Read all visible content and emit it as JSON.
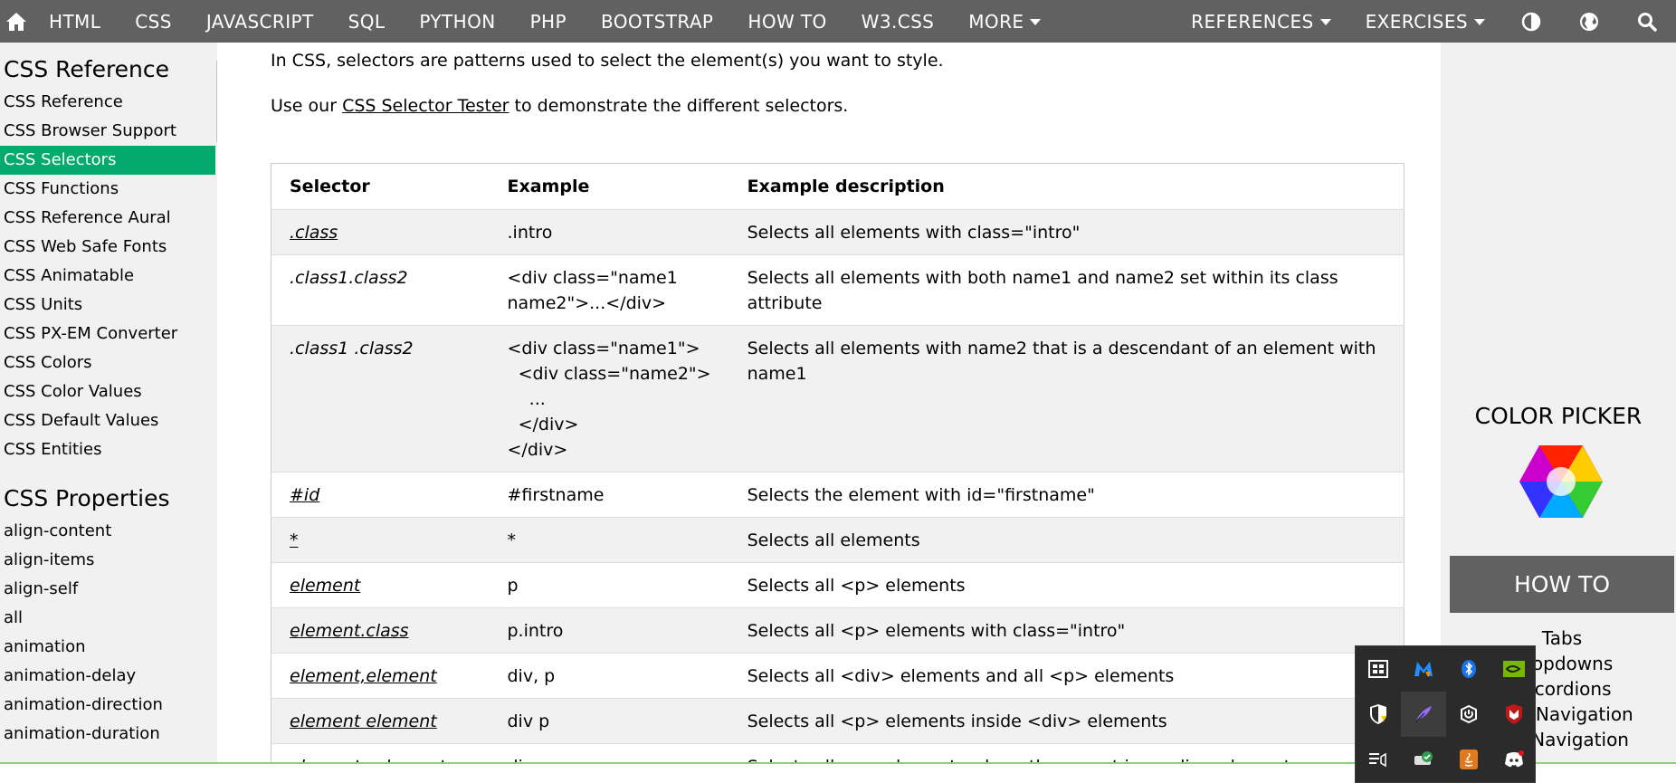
{
  "topnav": {
    "home_icon": "home-icon",
    "items": [
      "HTML",
      "CSS",
      "JAVASCRIPT",
      "SQL",
      "PYTHON",
      "PHP",
      "BOOTSTRAP",
      "HOW TO",
      "W3.CSS",
      "MORE"
    ],
    "right_items": [
      "REFERENCES",
      "EXERCISES"
    ],
    "icons": [
      "contrast-icon",
      "globe-icon",
      "search-icon"
    ]
  },
  "sidebar": {
    "heading1": "CSS Reference",
    "links1": [
      "CSS Reference",
      "CSS Browser Support",
      "CSS Selectors",
      "CSS Functions",
      "CSS Reference Aural",
      "CSS Web Safe Fonts",
      "CSS Animatable",
      "CSS Units",
      "CSS PX-EM Converter",
      "CSS Colors",
      "CSS Color Values",
      "CSS Default Values",
      "CSS Entities"
    ],
    "active": "CSS Selectors",
    "heading2": "CSS Properties",
    "links2": [
      "align-content",
      "align-items",
      "align-self",
      "all",
      "animation",
      "animation-delay",
      "animation-direction",
      "animation-duration"
    ]
  },
  "main": {
    "intro": "In CSS, selectors are patterns used to select the element(s) you want to style.",
    "tester_prefix": "Use our ",
    "tester_link": "CSS Selector Tester",
    "tester_suffix": " to demonstrate the different selectors.",
    "table": {
      "headers": [
        "Selector",
        "Example",
        "Example description"
      ],
      "rows": [
        {
          "selector": ".class",
          "example": ".intro",
          "description": "Selects all elements with class=\"intro\""
        },
        {
          "selector": ".class1.class2",
          "example": "<div class=\"name1\nname2\">...</div>",
          "description": "Selects all elements with both name1 and name2 set within its class attribute"
        },
        {
          "selector": ".class1 .class2",
          "example": "<div class=\"name1\">\n  <div class=\"name2\">\n    ...\n  </div>\n</div>",
          "description": "Selects all elements with name2 that is a descendant of an element with name1"
        },
        {
          "selector": "#id",
          "example": "#firstname",
          "description": "Selects the element with id=\"firstname\""
        },
        {
          "selector": "*",
          "example": "*",
          "description": "Selects all elements"
        },
        {
          "selector": "element",
          "example": "p",
          "description": "Selects all <p> elements"
        },
        {
          "selector": "element.class",
          "example": "p.intro",
          "description": "Selects all <p> elements with class=\"intro\""
        },
        {
          "selector": "element,element",
          "example": "div, p",
          "description": "Selects all <div> elements and all <p> elements"
        },
        {
          "selector": "element element",
          "example": "div p",
          "description": "Selects all <p> elements inside <div> elements"
        },
        {
          "selector": "element>element",
          "example": "div > p",
          "description": "Selects all <p> elements where the parent is a <div> element"
        }
      ]
    }
  },
  "rightcol": {
    "color_picker": "COLOR PICKER",
    "howto_title": "HOW TO",
    "howto_items": [
      "Tabs",
      "Dropdowns",
      "Accordions",
      "Side Navigation",
      "Top Navigation"
    ]
  },
  "tray": {
    "icons": [
      "window-capture-icon",
      "malwarebytes-icon",
      "bluetooth-icon",
      "nvidia-icon",
      "security-shield-icon",
      "feather-pen-icon",
      "power-icon",
      "mcafee-icon",
      "media-list-icon",
      "drive-check-icon",
      "java-icon",
      "discord-icon"
    ]
  },
  "colors": {
    "nav_bg": "#616161",
    "active_green": "#04aa6d",
    "sidebar_bg": "#f1f1f1",
    "tray_bg": "#2b2b2b"
  }
}
